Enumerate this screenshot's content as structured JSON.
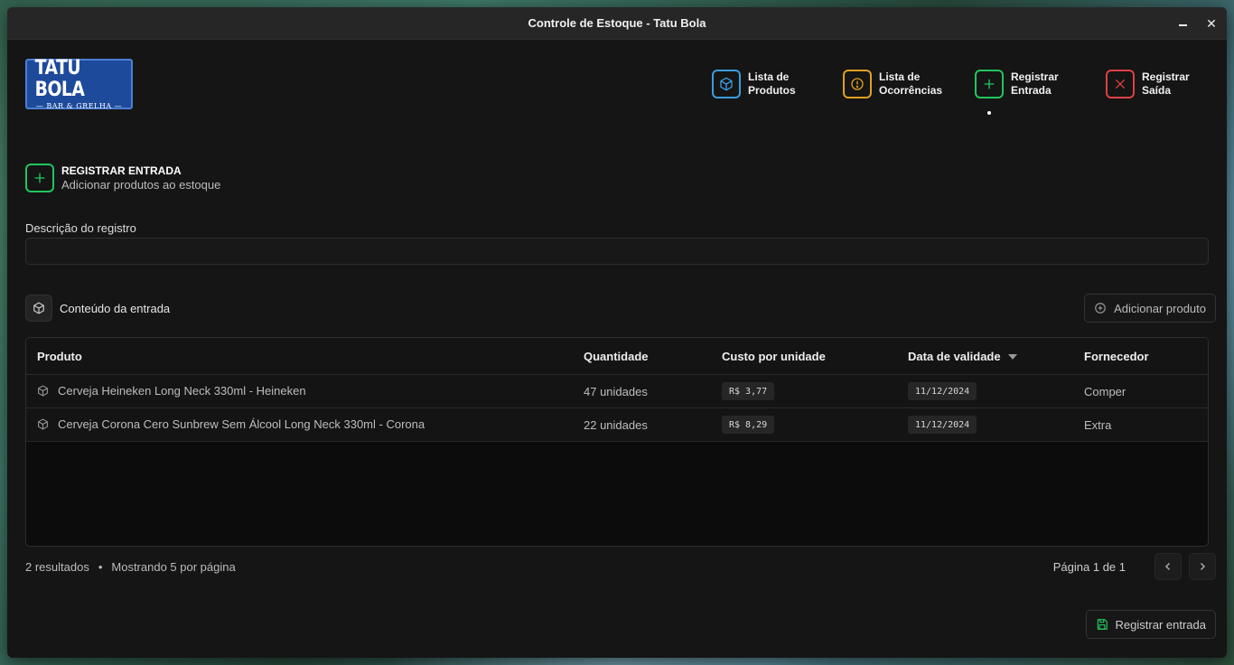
{
  "window": {
    "title": "Controle de Estoque - Tatu Bola",
    "minimize_icon": "minimize-icon",
    "close_label": "✕"
  },
  "logo": {
    "main": "TATU BOLA",
    "sub": "BAR & GRELHA"
  },
  "nav": {
    "items": [
      {
        "line1": "Lista de",
        "line2": "Produtos",
        "icon": "box-icon",
        "color": "#3b9ce0"
      },
      {
        "line1": "Lista de",
        "line2": "Ocorrências",
        "icon": "alert-circle-icon",
        "color": "#e0a020"
      },
      {
        "line1": "Registrar",
        "line2": "Entrada",
        "icon": "plus-icon",
        "color": "#22c55e",
        "active": true
      },
      {
        "line1": "Registrar",
        "line2": "Saída",
        "icon": "x-icon",
        "color": "#e04040"
      }
    ]
  },
  "section": {
    "title": "REGISTRAR ENTRADA",
    "subtitle": "Adicionar produtos ao estoque"
  },
  "form": {
    "description_label": "Descrição do registro",
    "description_value": "",
    "description_placeholder": ""
  },
  "entry": {
    "content_label": "Conteúdo da entrada",
    "add_product_label": "Adicionar produto"
  },
  "table": {
    "columns": [
      "Produto",
      "Quantidade",
      "Custo por unidade",
      "Data de validade",
      "Fornecedor"
    ],
    "rows": [
      {
        "produto": "Cerveja Heineken Long Neck 330ml - Heineken",
        "quantidade": "47 unidades",
        "custo": "R$ 3,77",
        "validade": "11/12/2024",
        "fornecedor": "Comper"
      },
      {
        "produto": "Cerveja Corona Cero Sunbrew Sem Álcool Long Neck 330ml - Corona",
        "quantidade": "22 unidades",
        "custo": "R$ 8,29",
        "validade": "11/12/2024",
        "fornecedor": "Extra"
      }
    ]
  },
  "footer": {
    "results": "2 resultados",
    "separator": "•",
    "per_page": "Mostrando 5 por página",
    "page": "Página 1 de 1"
  },
  "submit": {
    "label": "Registrar entrada"
  },
  "colors": {
    "accent_green": "#22c55e",
    "accent_blue": "#3b9ce0",
    "accent_yellow": "#e0a020",
    "accent_red": "#e04040"
  }
}
